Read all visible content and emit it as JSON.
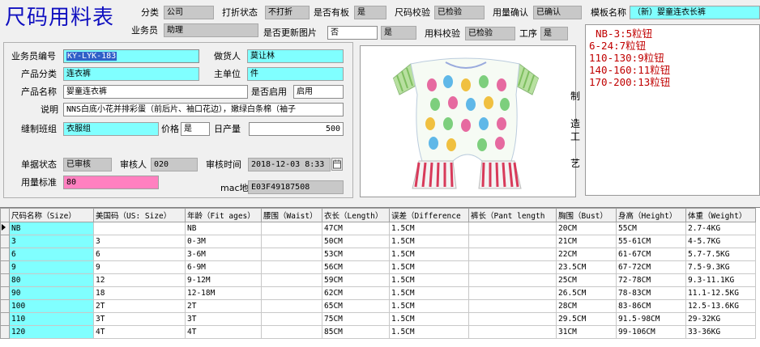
{
  "header": {
    "title": "尺码用料表"
  },
  "top": {
    "category_label": "分类",
    "category_value": "公司",
    "print_status_label": "打折状态",
    "print_status_value": "不打折",
    "has_template_label": "是否有板",
    "has_template_value": "是",
    "size_check_label": "尺码校验",
    "size_check_value": "已检验",
    "usage_confirm_label": "用量确认",
    "usage_confirm_value": "已确认",
    "template_name_label": "模板名称",
    "template_name_value": "（新）婴童连衣长裤",
    "salesman_label": "业务员",
    "salesman_value": "助理",
    "update_image_label": "是否更新图片",
    "update_image_value": "否",
    "update_image_value2": "是",
    "material_check_label": "用料校验",
    "material_check_value": "已检验",
    "process_label": "工序",
    "process_value": "是"
  },
  "form": {
    "salesman_no_label": "业务员编号",
    "salesman_no_value": "KY-LYK-183",
    "maker_label": "做货人",
    "maker_value": "莫让林",
    "product_category_label": "产品分类",
    "product_category_value": "连衣裤",
    "main_unit_label": "主单位",
    "main_unit_value": "件",
    "product_name_label": "产品名称",
    "product_name_value": "婴童连衣裤",
    "enabled_label": "是否启用",
    "enabled_value": "启用",
    "description_label": "说明",
    "description_value": "NNS白底小花并排彩蛋（前后片、袖口花边），嫩绿白条棉（袖子",
    "team_label": "缝制班组",
    "team_value": "衣服组",
    "price_label": "价格",
    "price_value": "是",
    "daily_output_label": "日产量",
    "daily_output_value": "500",
    "doc_status_label": "单据状态",
    "doc_status_value": "已审核",
    "reviewer_label": "审核人",
    "reviewer_value": "020",
    "review_time_label": "审核时间",
    "review_time_value": "2018-12-03   8:33",
    "usage_std_label": "用量标准",
    "usage_std_value": "80",
    "mac_label": "mac地址",
    "mac_value": "E03F49187508"
  },
  "craft": {
    "vertical_label": [
      "制",
      "造",
      "工",
      "艺"
    ],
    "lines": [
      "NB-3:5粒钮",
      "6-24:7粒钮",
      "110-130:9粒钮",
      "140-160:11粒钮",
      "170-200:13粒钮"
    ]
  },
  "grid": {
    "columns": [
      "尺码名称（Size）",
      "美国码（US: Size）",
      "年龄（Fit ages）",
      "腰围（Waist）",
      "衣长（Length）",
      "误差（Difference",
      "裤长（Pant length",
      "胸围（Bust）",
      "身高（Height）",
      "体重（Weight）"
    ],
    "rows": [
      [
        "NB",
        "",
        "NB",
        "",
        "47CM",
        "1.5CM",
        "",
        "20CM",
        "55CM",
        "2.7-4KG"
      ],
      [
        "3",
        "3",
        "0-3M",
        "",
        "50CM",
        "1.5CM",
        "",
        "21CM",
        "55-61CM",
        "4-5.7KG"
      ],
      [
        "6",
        "6",
        "3-6M",
        "",
        "53CM",
        "1.5CM",
        "",
        "22CM",
        "61-67CM",
        "5.7-7.5KG"
      ],
      [
        "9",
        "9",
        "6-9M",
        "",
        "56CM",
        "1.5CM",
        "",
        "23.5CM",
        "67-72CM",
        "7.5-9.3KG"
      ],
      [
        "80",
        "12",
        "9-12M",
        "",
        "59CM",
        "1.5CM",
        "",
        "25CM",
        "72-78CM",
        "9.3-11.1KG"
      ],
      [
        "90",
        "18",
        "12-18M",
        "",
        "62CM",
        "1.5CM",
        "",
        "26.5CM",
        "78-83CM",
        "11.1-12.5KG"
      ],
      [
        "100",
        "2T",
        "2T",
        "",
        "65CM",
        "1.5CM",
        "",
        "28CM",
        "83-86CM",
        "12.5-13.6KG"
      ],
      [
        "110",
        "3T",
        "3T",
        "",
        "75CM",
        "1.5CM",
        "",
        "29.5CM",
        "91.5-98CM",
        "29-32KG"
      ],
      [
        "120",
        "4T",
        "4T",
        "",
        "85CM",
        "1.5CM",
        "",
        "31CM",
        "99-106CM",
        "33-36KG"
      ]
    ]
  }
}
